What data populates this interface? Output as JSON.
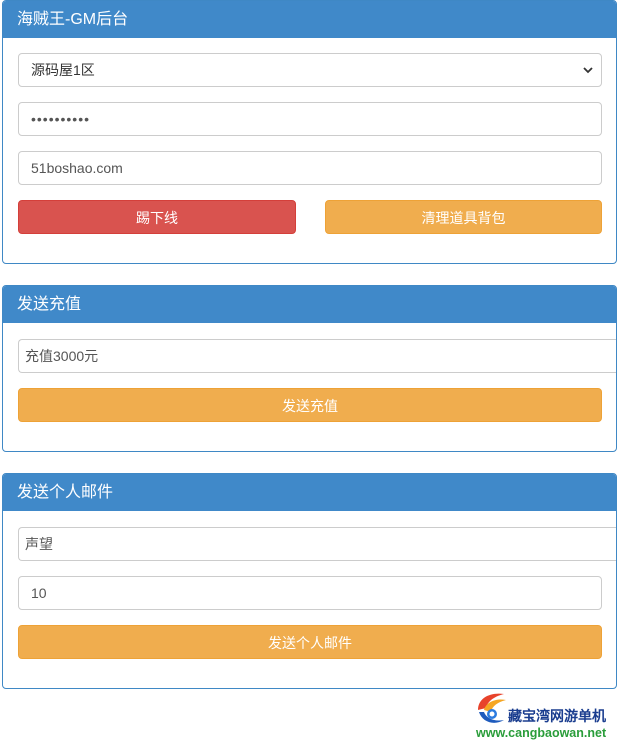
{
  "gm_panel": {
    "title": "海贼王-GM后台",
    "server_select_value": "源码屋1区",
    "password_value": "••••••••••",
    "account_value": "51boshao.com",
    "kick_button": "踢下线",
    "clear_bag_button": "清理道具背包"
  },
  "recharge_panel": {
    "title": "发送充值",
    "amount_value": "充值3000元",
    "send_button": "发送充值"
  },
  "mail_panel": {
    "title": "发送个人邮件",
    "item_value": "声望",
    "quantity_value": "10",
    "send_button": "发送个人邮件"
  },
  "watermark": {
    "name": "藏宝湾网游单机",
    "url": "www.cangbaowan.net"
  },
  "colors": {
    "panel_header": "#4089c9",
    "danger": "#d9534f",
    "warning": "#f0ad4e"
  },
  "icons": [
    "chevron-down-icon",
    "cangbaowan-logo-icon"
  ]
}
